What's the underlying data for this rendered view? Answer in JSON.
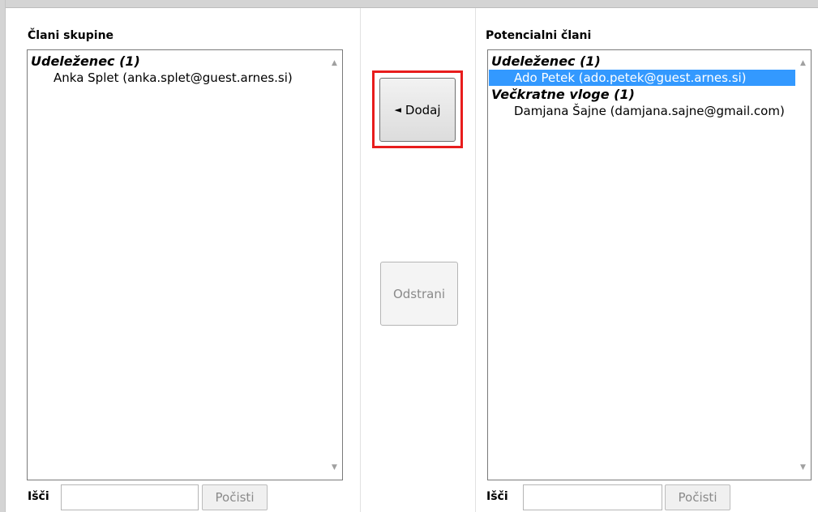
{
  "left_panel": {
    "label": "Člani skupine",
    "groups": [
      {
        "label": "Udeleženec (1)",
        "options": [
          {
            "text": "Anka Splet (anka.splet@guest.arnes.si)",
            "selected": false
          }
        ]
      }
    ],
    "search_label": "Išči",
    "search_value": "",
    "clear_label": "Počisti"
  },
  "right_panel": {
    "label": "Potencialni člani",
    "groups": [
      {
        "label": "Udeleženec (1)",
        "options": [
          {
            "text": "Ado Petek (ado.petek@guest.arnes.si)",
            "selected": true
          }
        ]
      },
      {
        "label": "Večkratne vloge (1)",
        "options": [
          {
            "text": "Damjana Šajne (damjana.sajne@gmail.com)",
            "selected": false
          }
        ]
      }
    ],
    "search_label": "Išči",
    "search_value": "",
    "clear_label": "Počisti"
  },
  "buttons": {
    "add_label": "Dodaj",
    "add_arrow": "◄",
    "remove_label": "Odstrani"
  },
  "colors": {
    "selection": "#3399ff",
    "highlight_box": "#e81c1c"
  }
}
